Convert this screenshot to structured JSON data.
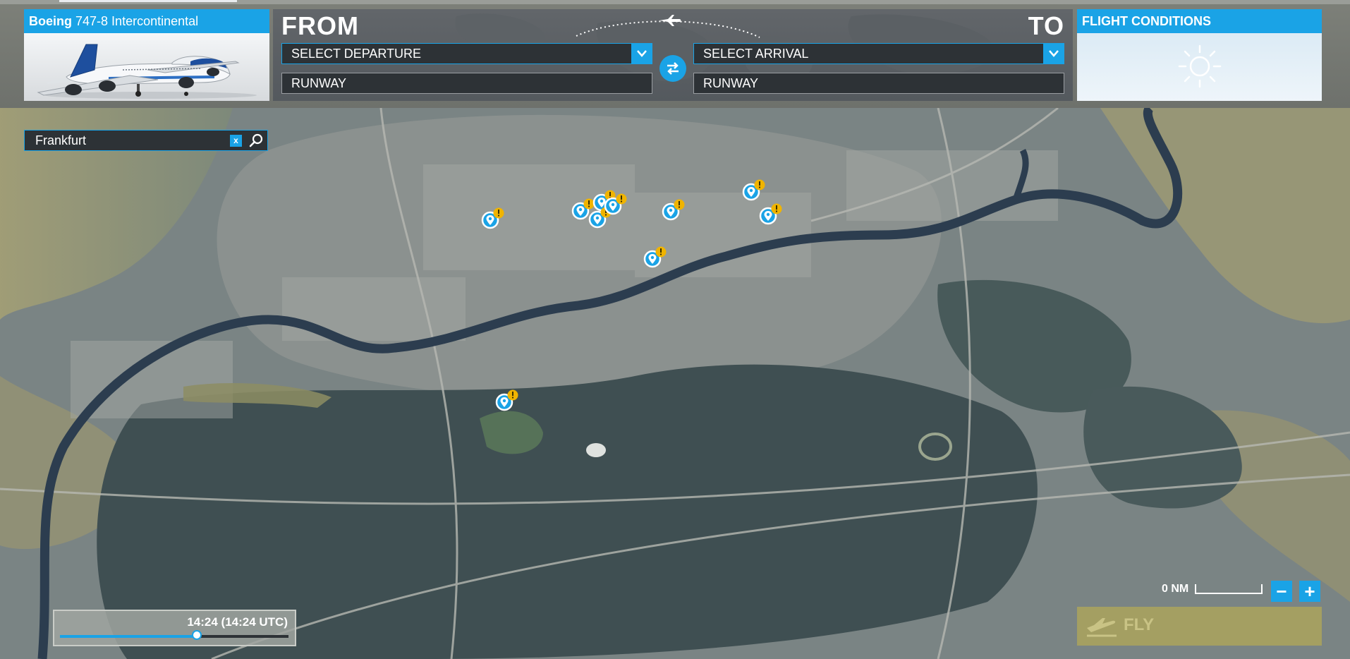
{
  "aircraft": {
    "make": "Boeing",
    "model": "747-8 Intercontinental"
  },
  "route": {
    "from_label": "FROM",
    "to_label": "TO",
    "departure_select": "SELECT DEPARTURE",
    "departure_runway": "RUNWAY",
    "arrival_select": "SELECT ARRIVAL",
    "arrival_runway": "RUNWAY",
    "icons": [
      "airplane-icon",
      "swap-icon",
      "chevron-down-icon"
    ]
  },
  "conditions": {
    "title": "FLIGHT CONDITIONS",
    "weather_icon": "sun-icon"
  },
  "map": {
    "search": {
      "value": "Frankfurt",
      "clear_label": "x",
      "icon": "search-icon"
    },
    "poi_count": 10,
    "poi_icons": [
      "map-pin-icon",
      "warning-icon"
    ],
    "scale_label": "0 NM",
    "zoom_out_label": "−",
    "zoom_in_label": "+"
  },
  "time": {
    "label": "14:24 (14:24 UTC)",
    "day_fraction": 0.6
  },
  "fly": {
    "label": "FLY",
    "icon": "airplane-takeoff-icon"
  },
  "colors": {
    "accent": "#1aa3e6",
    "panel_dark": "#2d3236",
    "warning": "#f0b400",
    "fly_button": "#a49f62"
  }
}
